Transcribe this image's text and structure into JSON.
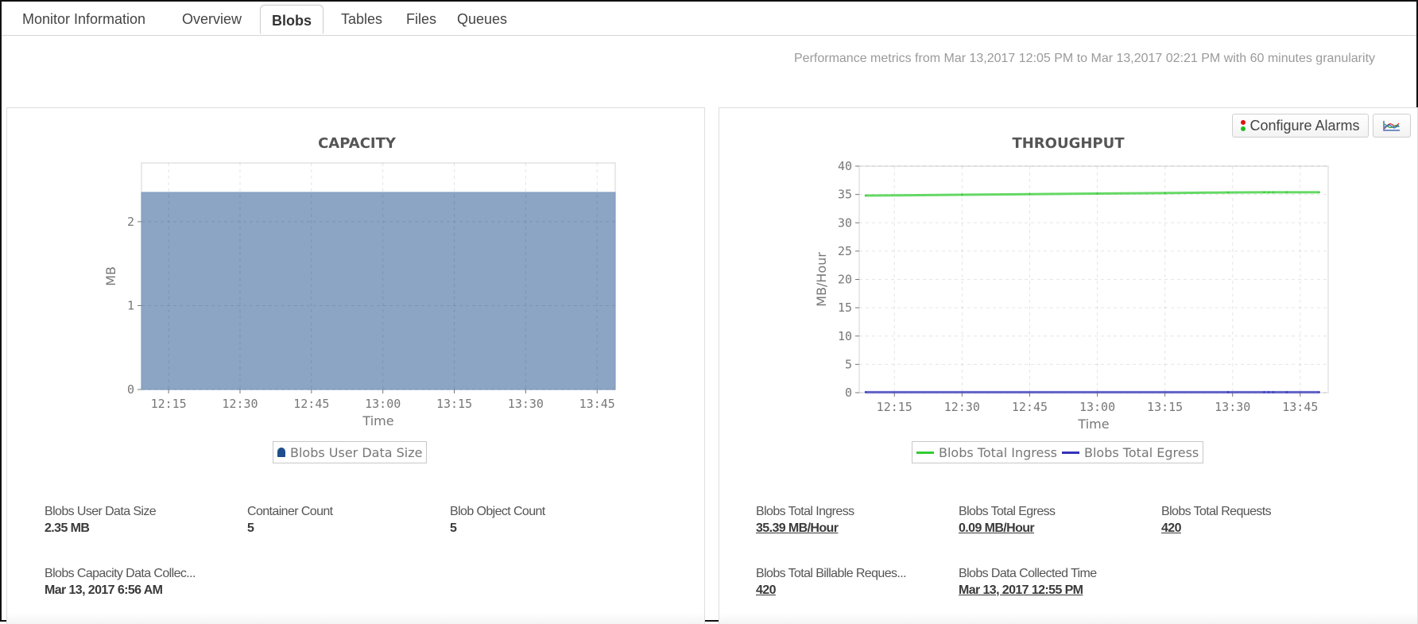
{
  "tabs": [
    {
      "label": "Monitor Information",
      "active": false
    },
    {
      "label": "Overview",
      "active": false
    },
    {
      "label": "Blobs",
      "active": true
    },
    {
      "label": "Tables",
      "active": false
    },
    {
      "label": "Files",
      "active": false
    },
    {
      "label": "Queues",
      "active": false
    }
  ],
  "performance_note": "Performance metrics from Mar 13,2017 12:05 PM to Mar 13,2017 02:21 PM with 60 minutes granularity",
  "toolbar": {
    "configure_alarms_label": "Configure Alarms",
    "configure_alarms_icon": "traffic-light-icon",
    "chart_type_icon": "line-chart-icon"
  },
  "colors": {
    "capacity_area": "#8ca5c4",
    "capacity_legend": "#1f4e8c",
    "ingress": "#33cc33",
    "egress": "#3333bb",
    "grid": "#dddddd"
  },
  "chart_data": [
    {
      "type": "area",
      "title": "CAPACITY",
      "xlabel": "Time",
      "ylabel": "MB",
      "x_ticks": [
        "12:15",
        "12:30",
        "12:45",
        "13:00",
        "13:15",
        "13:30",
        "13:45"
      ],
      "y_ticks": [
        0,
        1,
        2
      ],
      "ylim": [
        0,
        2.7
      ],
      "xlim_minutes": [
        729.3,
        828.8
      ],
      "grid": true,
      "legend_position": "bottom",
      "series": [
        {
          "name": "Blobs User Data Size",
          "x_minutes": [
            729.3,
            828.8
          ],
          "values": [
            2.35,
            2.35
          ]
        }
      ]
    },
    {
      "type": "line",
      "title": "THROUGHPUT",
      "xlabel": "Time",
      "ylabel": "MB/Hour",
      "x_ticks": [
        "12:15",
        "12:30",
        "12:45",
        "13:00",
        "13:15",
        "13:30",
        "13:45"
      ],
      "y_ticks": [
        0,
        5,
        10,
        15,
        20,
        25,
        30,
        35,
        40
      ],
      "ylim": [
        0,
        40
      ],
      "xlim_minutes": [
        727.2,
        831.2
      ],
      "grid": true,
      "legend_position": "bottom",
      "series": [
        {
          "name": "Blobs Total Ingress",
          "x_minutes": [
            728.6,
            750,
            765,
            780,
            795,
            809,
            817,
            818,
            819,
            822,
            829.2
          ],
          "values": [
            34.8,
            34.95,
            35.05,
            35.15,
            35.25,
            35.35,
            35.38,
            35.38,
            35.38,
            35.39,
            35.39
          ]
        },
        {
          "name": "Blobs Total Egress",
          "x_minutes": [
            728.6,
            809,
            817,
            818,
            819,
            822,
            829.2
          ],
          "values": [
            0.09,
            0.09,
            0.09,
            0.09,
            0.09,
            0.09,
            0.09
          ]
        }
      ]
    }
  ],
  "capacity_stats": [
    {
      "label": "Blobs User Data Size",
      "value": "2.35 MB",
      "link": false
    },
    {
      "label": "Container Count",
      "value": "5",
      "link": false
    },
    {
      "label": "Blob Object Count",
      "value": "5",
      "link": false
    },
    {
      "label": "Blobs Capacity Data Collec...",
      "value": "Mar 13, 2017 6:56 AM",
      "link": false
    }
  ],
  "throughput_stats": [
    {
      "label": "Blobs Total Ingress",
      "value": "35.39 MB/Hour",
      "link": true
    },
    {
      "label": "Blobs Total Egress",
      "value": "0.09 MB/Hour",
      "link": true
    },
    {
      "label": "Blobs Total Requests",
      "value": "420",
      "link": true
    },
    {
      "label": "Blobs Total Billable Reques...",
      "value": "420",
      "link": true
    },
    {
      "label": "Blobs Data Collected Time",
      "value": "Mar 13, 2017 12:55 PM",
      "link": true
    }
  ]
}
